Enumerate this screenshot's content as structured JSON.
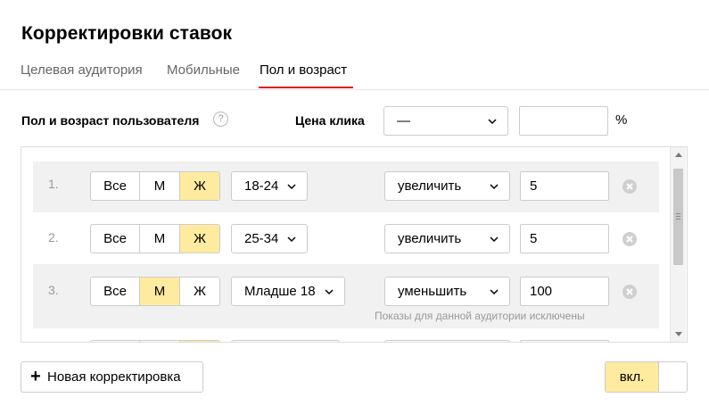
{
  "title": "Корректировки ставок",
  "tabs": [
    {
      "label": "Целевая аудитория",
      "active": false
    },
    {
      "label": "Мобильные",
      "active": false
    },
    {
      "label": "Пол и возраст",
      "active": true
    }
  ],
  "header": {
    "section_label": "Пол и возраст пользователя",
    "help_glyph": "?",
    "click_price_label": "Цена клика",
    "click_price_select": "—",
    "click_price_input": "",
    "percent": "%"
  },
  "rows": [
    {
      "num": "1.",
      "gender": [
        "Все",
        "М",
        "Ж"
      ],
      "selected_gender": "Ж",
      "age": "18-24",
      "action": "увеличить",
      "value": "5",
      "hint": ""
    },
    {
      "num": "2.",
      "gender": [
        "Все",
        "М",
        "Ж"
      ],
      "selected_gender": "Ж",
      "age": "25-34",
      "action": "увеличить",
      "value": "5",
      "hint": ""
    },
    {
      "num": "3.",
      "gender": [
        "Все",
        "М",
        "Ж"
      ],
      "selected_gender": "М",
      "age": "Младше 18",
      "action": "уменьшить",
      "value": "100",
      "hint": "Показы для данной аудитории исключены"
    }
  ],
  "footer": {
    "add_plus": "+",
    "add_label": "Новая корректировка",
    "toggle_label": "вкл."
  },
  "colors": {
    "accent_selected": "#ffeba0",
    "tab_underline": "#e0201c",
    "border": "#cccccc",
    "row_shade": "#f1f1f1"
  },
  "icons": [
    "help-icon",
    "chevron-down-icon",
    "clear-icon",
    "plus-icon"
  ]
}
